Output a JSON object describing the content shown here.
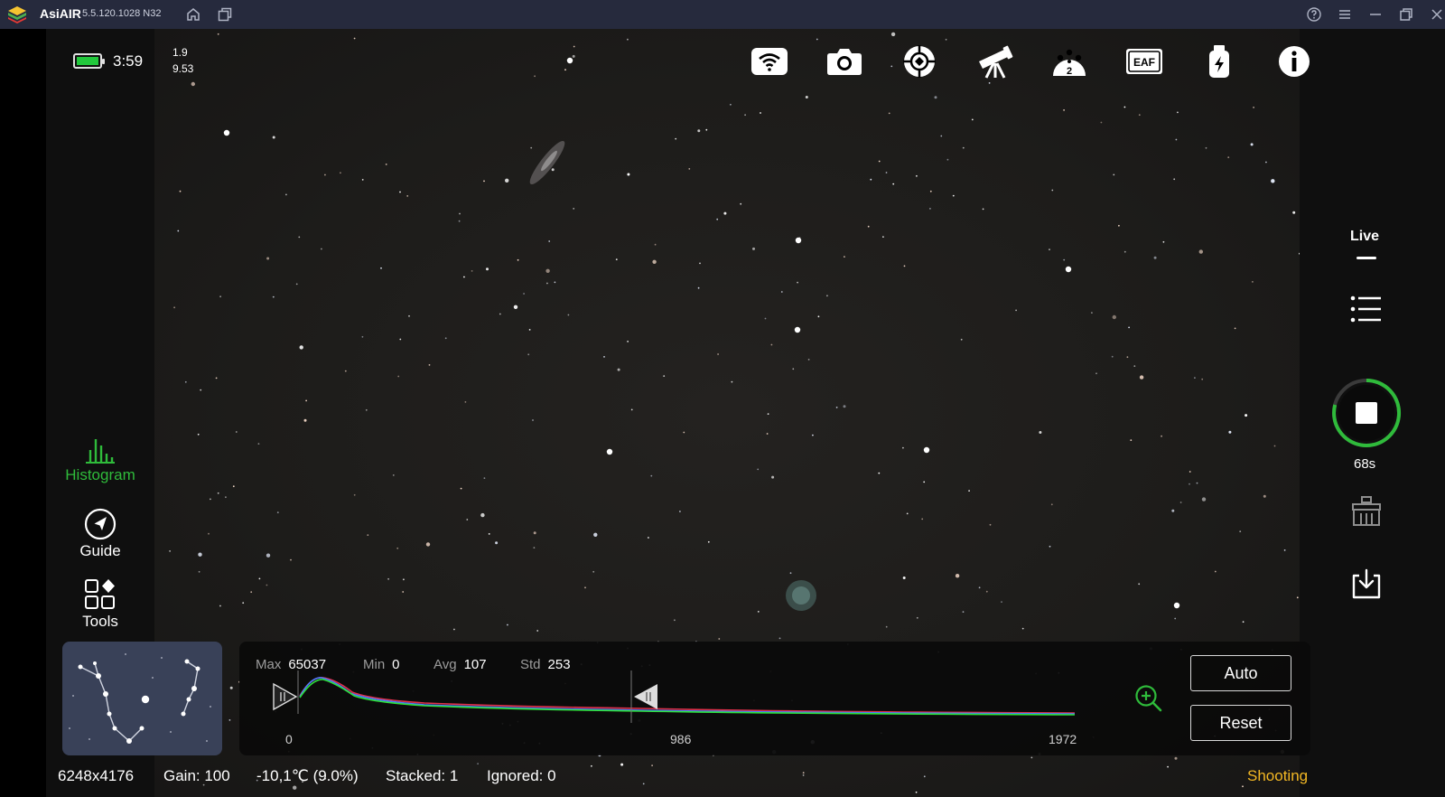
{
  "titlebar": {
    "app_name": "AsiAIR",
    "version": "5.5.120.1028  N32",
    "icons": [
      "bluestacks-logo-icon",
      "home-icon",
      "multi-window-icon",
      "help-icon",
      "menu-icon",
      "minimize-icon",
      "restore-icon",
      "close-icon"
    ]
  },
  "status": {
    "time": "3:59",
    "line1": "1.9",
    "line2": "9.53",
    "battery_level": 1.0
  },
  "toolbar": {
    "icons": [
      "wifi-icon",
      "camera-icon",
      "guide-scope-icon",
      "telescope-icon",
      "filter-wheel-icon",
      "eaf-icon",
      "power-usb-icon",
      "info-icon"
    ],
    "filter_wheel_slot": "2",
    "eaf_label": "EAF"
  },
  "leftnav": [
    {
      "label": "Histogram",
      "icon": "histogram-icon",
      "active": true
    },
    {
      "label": "Guide",
      "icon": "guide-compass-icon",
      "active": false
    },
    {
      "label": "Tools",
      "icon": "tools-grid-icon",
      "active": false
    }
  ],
  "rightnav": {
    "live_label": "Live",
    "timer": "68s",
    "icons": [
      "list-icon",
      "stop-icon",
      "calibration-icon",
      "download-icon"
    ]
  },
  "histogram": {
    "stats": {
      "max_label": "Max",
      "max": "65037",
      "min_label": "Min",
      "min": "0",
      "avg_label": "Avg",
      "avg": "107",
      "std_label": "Std",
      "std": "253"
    },
    "ticks": [
      "0",
      "986",
      "1972"
    ],
    "auto_label": "Auto",
    "reset_label": "Reset",
    "colors": {
      "red": "#e0304a",
      "green": "#2ee03a",
      "blue": "#4a7bff"
    }
  },
  "bottom": {
    "resolution": "6248x4176",
    "gain": "Gain: 100",
    "temperature": "-10,1℃  (9.0%)",
    "stacked": "Stacked: 1",
    "ignored": "Ignored: 0",
    "state": "Shooting"
  },
  "accent": "#2fbb3b"
}
